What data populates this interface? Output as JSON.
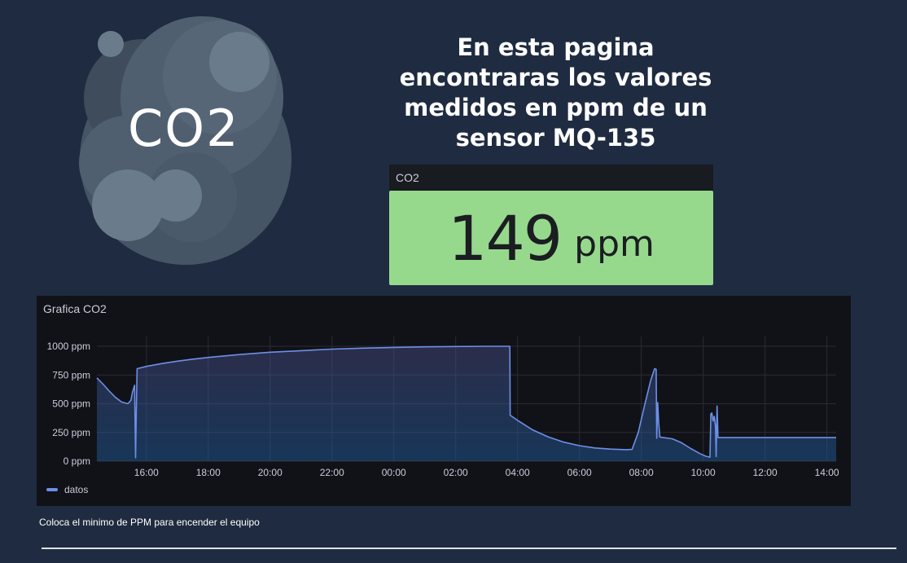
{
  "logo": {
    "text": "CO2"
  },
  "headline": "En esta pagina encontraras los valores medidos en ppm de un sensor MQ-135",
  "stat": {
    "title": "CO2",
    "value": "149",
    "unit": "ppm",
    "background": "#96d98d"
  },
  "chart_panel": {
    "title": "Grafica CO2"
  },
  "chart_data": {
    "type": "area",
    "y_ticks": [
      "0 ppm",
      "250 ppm",
      "500 ppm",
      "750 ppm",
      "1000 ppm"
    ],
    "y_tick_values": [
      0,
      250,
      500,
      750,
      1000
    ],
    "ylim": [
      0,
      1000
    ],
    "x_ticks": [
      "16:00",
      "18:00",
      "20:00",
      "22:00",
      "00:00",
      "02:00",
      "04:00",
      "06:00",
      "08:00",
      "10:00",
      "12:00",
      "14:00"
    ],
    "x_tick_hours": [
      16,
      18,
      20,
      22,
      24,
      26,
      28,
      30,
      32,
      34,
      36,
      38
    ],
    "xlim_hours": [
      14.4,
      38.3
    ],
    "grid": true,
    "legend_position": "bottom-left",
    "series": [
      {
        "name": "datos",
        "color": "#6d8fe8",
        "points": [
          [
            14.4,
            725
          ],
          [
            14.6,
            670
          ],
          [
            14.8,
            610
          ],
          [
            15.0,
            555
          ],
          [
            15.2,
            515
          ],
          [
            15.4,
            500
          ],
          [
            15.5,
            530
          ],
          [
            15.55,
            600
          ],
          [
            15.62,
            660
          ],
          [
            15.65,
            30
          ],
          [
            15.68,
            500
          ],
          [
            15.7,
            805
          ],
          [
            16.0,
            825
          ],
          [
            16.5,
            850
          ],
          [
            17.0,
            870
          ],
          [
            17.5,
            888
          ],
          [
            18.0,
            903
          ],
          [
            19.0,
            928
          ],
          [
            20.0,
            948
          ],
          [
            21.0,
            962
          ],
          [
            22.0,
            975
          ],
          [
            23.0,
            984
          ],
          [
            24.0,
            990
          ],
          [
            25.0,
            995
          ],
          [
            26.0,
            998
          ],
          [
            27.0,
            1000
          ],
          [
            27.75,
            1000
          ],
          [
            27.76,
            400
          ],
          [
            28.0,
            355
          ],
          [
            28.5,
            270
          ],
          [
            29.0,
            210
          ],
          [
            29.5,
            165
          ],
          [
            30.0,
            135
          ],
          [
            30.5,
            115
          ],
          [
            31.0,
            105
          ],
          [
            31.5,
            100
          ],
          [
            31.7,
            102
          ],
          [
            31.9,
            250
          ],
          [
            32.1,
            480
          ],
          [
            32.3,
            700
          ],
          [
            32.43,
            805
          ],
          [
            32.48,
            800
          ],
          [
            32.5,
            200
          ],
          [
            32.53,
            510
          ],
          [
            32.56,
            350
          ],
          [
            32.6,
            210
          ],
          [
            33.0,
            195
          ],
          [
            33.3,
            160
          ],
          [
            33.6,
            110
          ],
          [
            33.9,
            65
          ],
          [
            34.1,
            42
          ],
          [
            34.22,
            35
          ],
          [
            34.25,
            410
          ],
          [
            34.28,
            420
          ],
          [
            34.32,
            350
          ],
          [
            34.36,
            390
          ],
          [
            34.4,
            300
          ],
          [
            34.42,
            40
          ],
          [
            34.45,
            480
          ],
          [
            34.48,
            205
          ],
          [
            35.0,
            205
          ],
          [
            36.0,
            205
          ],
          [
            37.0,
            205
          ],
          [
            38.3,
            205
          ]
        ]
      }
    ]
  },
  "footer": {
    "text": "Coloca el minimo de PPM para encender el equipo"
  }
}
